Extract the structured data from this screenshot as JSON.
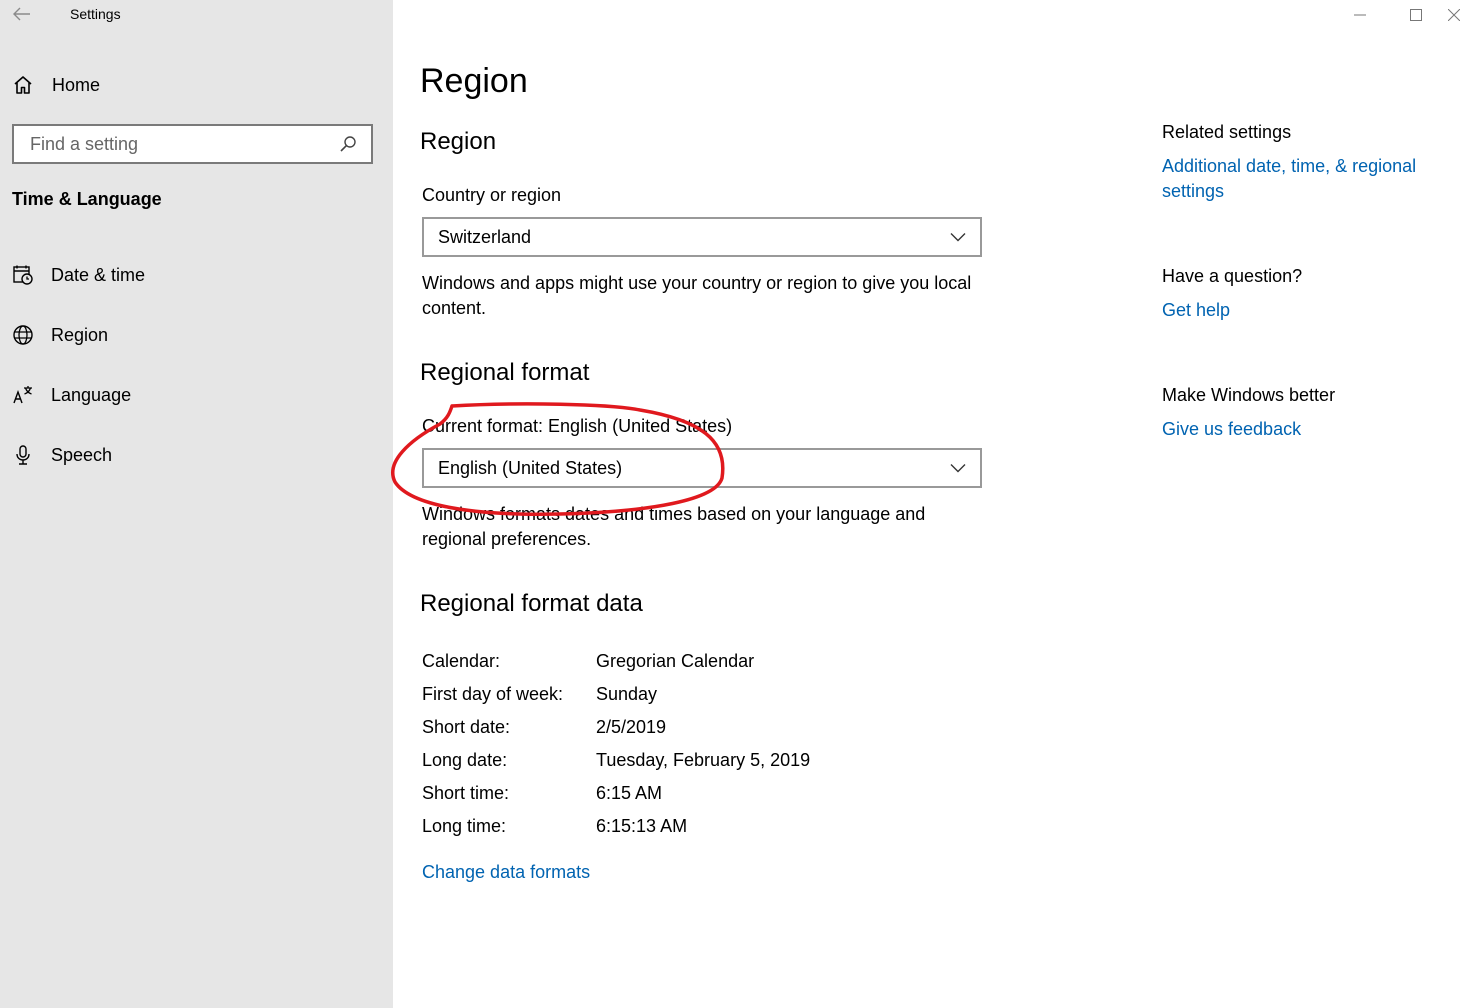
{
  "window": {
    "title": "Settings"
  },
  "sidebar": {
    "home_label": "Home",
    "search": {
      "placeholder": "Find a setting",
      "value": ""
    },
    "section_heading": "Time & Language",
    "items": [
      {
        "label": "Date & time",
        "icon": "calendar-clock-icon"
      },
      {
        "label": "Region",
        "icon": "globe-icon"
      },
      {
        "label": "Language",
        "icon": "language-icon"
      },
      {
        "label": "Speech",
        "icon": "microphone-icon"
      }
    ]
  },
  "main": {
    "page_title": "Region",
    "region_section": {
      "heading": "Region",
      "field_label": "Country or region",
      "selected_value": "Switzerland",
      "description": "Windows and apps might use your country or region to give you local content."
    },
    "regional_format_section": {
      "heading": "Regional format",
      "field_label": "Current format: English (United States)",
      "selected_value": "English (United States)",
      "description": "Windows formats dates and times based on your language and regional preferences."
    },
    "format_data_section": {
      "heading": "Regional format data",
      "rows": [
        {
          "key": "Calendar:",
          "value": "Gregorian Calendar"
        },
        {
          "key": "First day of week:",
          "value": "Sunday"
        },
        {
          "key": "Short date:",
          "value": "2/5/2019"
        },
        {
          "key": "Long date:",
          "value": "Tuesday, February 5, 2019"
        },
        {
          "key": "Short time:",
          "value": "6:15 AM"
        },
        {
          "key": "Long time:",
          "value": "6:15:13 AM"
        }
      ],
      "change_link": "Change data formats"
    }
  },
  "related": {
    "related_settings": {
      "title": "Related settings",
      "link": "Additional date, time, & regional settings"
    },
    "question": {
      "title": "Have a question?",
      "link": "Get help"
    },
    "feedback": {
      "title": "Make Windows better",
      "link": "Give us feedback"
    }
  },
  "colors": {
    "sidebar_bg": "#e6e6e6",
    "link": "#0063b1",
    "annotation": "#e0191e"
  }
}
